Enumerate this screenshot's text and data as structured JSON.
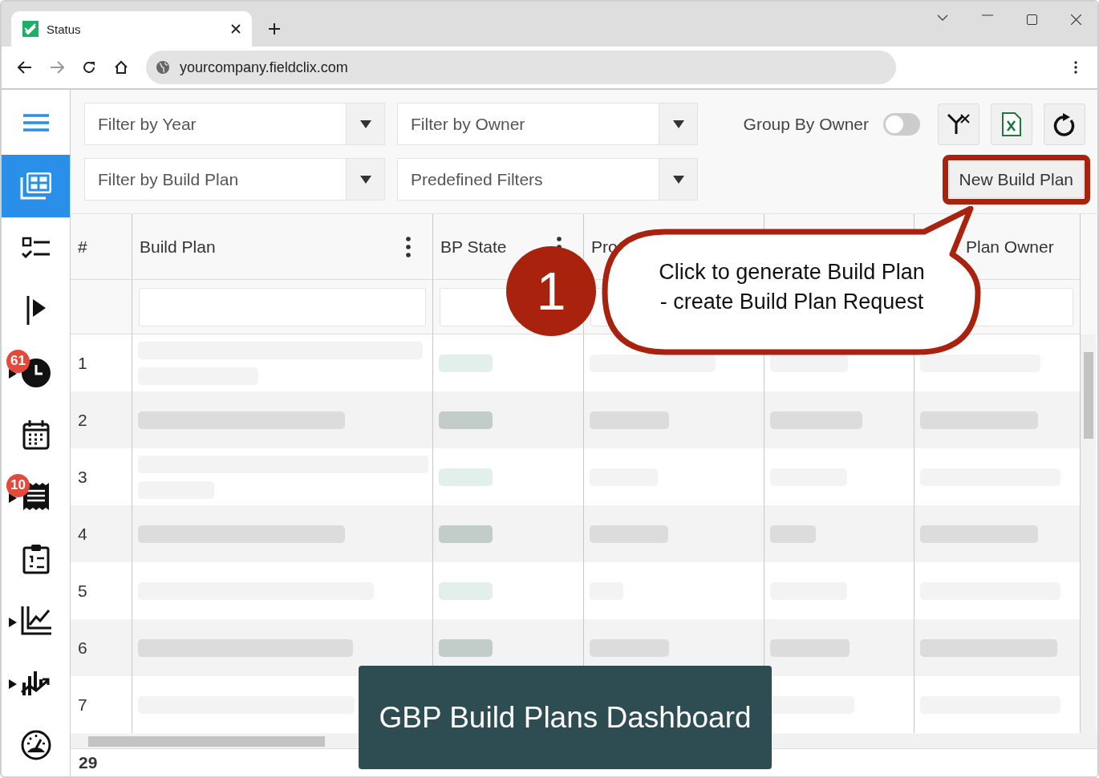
{
  "browser": {
    "tab_title": "Status",
    "url": "yourcompany.fieldclix.com"
  },
  "sidebar": {
    "items": [
      {
        "kind": "grid",
        "selected": true,
        "expandable": false
      },
      {
        "kind": "checklist",
        "selected": false,
        "expandable": false
      },
      {
        "kind": "flag",
        "selected": false,
        "expandable": false
      },
      {
        "kind": "clock",
        "selected": false,
        "expandable": true,
        "badge": "61"
      },
      {
        "kind": "calendar",
        "selected": false,
        "expandable": false
      },
      {
        "kind": "receipt",
        "selected": false,
        "expandable": true,
        "badge": "10"
      },
      {
        "kind": "clipboard",
        "selected": false,
        "expandable": false
      },
      {
        "kind": "chart",
        "selected": false,
        "expandable": true
      },
      {
        "kind": "trend",
        "selected": false,
        "expandable": true
      },
      {
        "kind": "gauge",
        "selected": false,
        "expandable": false
      }
    ]
  },
  "filters": [
    {
      "placeholder": "Filter by Year"
    },
    {
      "placeholder": "Filter by Owner"
    },
    {
      "placeholder": "Filter by Build Plan"
    },
    {
      "placeholder": "Predefined Filters"
    }
  ],
  "group_by_owner": {
    "label": "Group By Owner",
    "on": false
  },
  "new_button": "New Build Plan",
  "table": {
    "columns": [
      {
        "label": "#",
        "menu": false,
        "filter": false
      },
      {
        "label": "Build Plan",
        "menu": true,
        "filter": true
      },
      {
        "label": "BP State",
        "menu": true,
        "filter": true
      },
      {
        "label": "Pro",
        "menu": false,
        "filter": true
      },
      {},
      {
        "label": "Plan Owner",
        "menu": false,
        "filter": true
      }
    ],
    "rows": [
      {
        "number": "1"
      },
      {
        "number": "2"
      },
      {
        "number": "3"
      },
      {
        "number": "4"
      },
      {
        "number": "5"
      },
      {
        "number": "6"
      },
      {
        "number": "7"
      }
    ],
    "footer_count": "29"
  },
  "annotation": {
    "badge": "1",
    "callout_lines": [
      "Click to generate Build Plan",
      "- create Build Plan Request"
    ]
  },
  "caption": "GBP Build Plans Dashboard"
}
